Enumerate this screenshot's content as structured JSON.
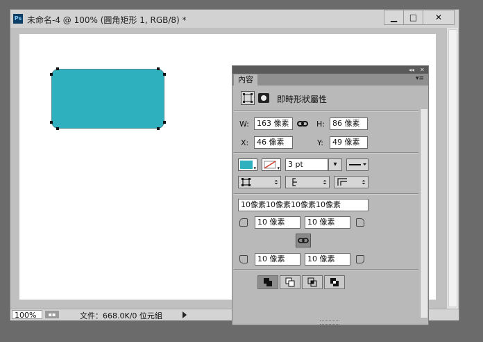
{
  "document": {
    "app_icon_text": "Ps",
    "title": "未命名-4 @ 100% (圓角矩形 1, RGB/8) *",
    "window_buttons": {
      "minimize": "▁",
      "maximize": "□",
      "close": "✕"
    },
    "status": {
      "zoom": "100%",
      "file_info": "文件：668.0K/0 位元組"
    }
  },
  "panel": {
    "tab_label": "內容",
    "collapse_glyph": "◂◂",
    "close_glyph": "✕",
    "menu_glyph": "▾≡",
    "section_title": "即時形狀屬性",
    "size": {
      "w_label": "W:",
      "w_value": "163 像素",
      "h_label": "H:",
      "h_value": "86 像素",
      "x_label": "X:",
      "x_value": "46 像素",
      "y_label": "Y:",
      "y_value": "49 像素"
    },
    "appearance": {
      "fill_color": "#2fb0bf",
      "stroke_width": "3 pt"
    },
    "corners": {
      "summary": "10像素10像素10像素10像素",
      "top_left": "10 像素",
      "top_right": "10 像素",
      "bottom_left": "10 像素",
      "bottom_right": "10 像素"
    },
    "icons": {
      "link": "link-icon",
      "corner_link": "chain-link-icon"
    }
  },
  "colors": {
    "accent_fill": "#2fb0bf",
    "workspace": "#6b6b6b",
    "panel_bg": "#b9b9b9"
  }
}
